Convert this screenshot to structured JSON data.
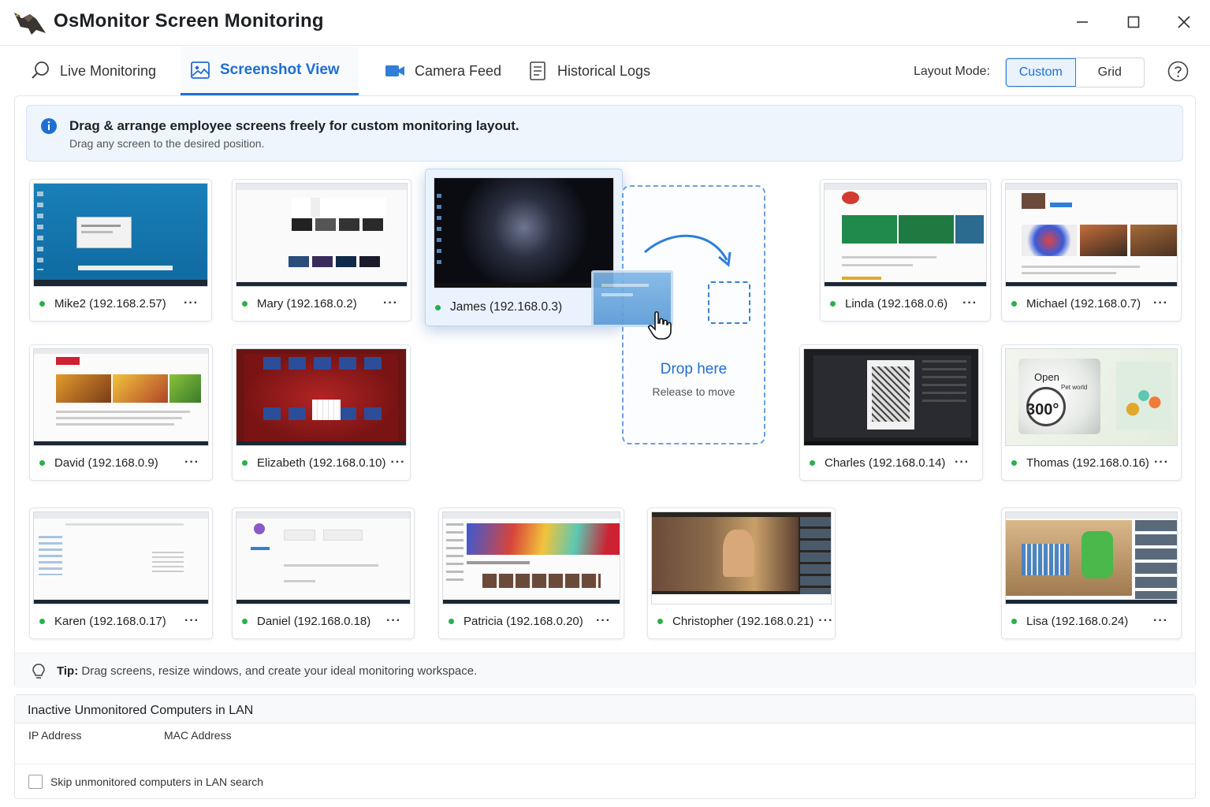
{
  "app": {
    "title": "OsMonitor Screen Monitoring"
  },
  "tabs": [
    {
      "label": "Live Monitoring",
      "icon": "search-icon"
    },
    {
      "label": "Screenshot View",
      "icon": "image-icon",
      "active": true
    },
    {
      "label": "Camera Feed",
      "icon": "camera-icon"
    },
    {
      "label": "Historical Logs",
      "icon": "log-icon"
    }
  ],
  "layout": {
    "label": "Layout Mode:",
    "options": [
      "Custom",
      "Grid"
    ],
    "selected": "Custom"
  },
  "banner": {
    "title": "Drag & arrange employee screens freely for custom monitoring layout.",
    "subtitle": "Drag any screen to the desired position."
  },
  "screens": [
    {
      "name": "Mike2 (192.168.2.57)",
      "more": "···",
      "status_color": "#2bb04a"
    },
    {
      "name": "Mary (192.168.0.2)",
      "more": "···",
      "status_color": "#2bb04a"
    },
    {
      "name": "James (192.168.0.3)",
      "more": "",
      "status_color": "#2bb04a"
    },
    {
      "name": "Linda (192.168.0.6)",
      "more": "···",
      "status_color": "#2bb04a"
    },
    {
      "name": "Michael (192.168.0.7)",
      "more": "···",
      "status_color": "#2bb04a"
    },
    {
      "name": "David (192.168.0.9)",
      "more": "···",
      "status_color": "#2bb04a"
    },
    {
      "name": "Elizabeth (192.168.0.10)",
      "more": "···",
      "status_color": "#2bb04a"
    },
    {
      "name": "Charles (192.168.0.14)",
      "more": "···",
      "status_color": "#2bb04a"
    },
    {
      "name": "Thomas (192.168.0.16)",
      "more": "···",
      "status_color": "#2bb04a"
    },
    {
      "name": "Karen (192.168.0.17)",
      "more": "···",
      "status_color": "#2bb04a"
    },
    {
      "name": "Daniel (192.168.0.18)",
      "more": "···",
      "status_color": "#2bb04a"
    },
    {
      "name": "Patricia (192.168.0.20)",
      "more": "···",
      "status_color": "#2bb04a"
    },
    {
      "name": "Christopher (192.168.0.21)",
      "more": "···",
      "status_color": "#2bb04a"
    },
    {
      "name": "Lisa (192.168.0.24)",
      "more": "···",
      "status_color": "#2bb04a"
    }
  ],
  "dropzone": {
    "title": "Drop here",
    "subtitle": "Release to move"
  },
  "thumb_text": {
    "thomas_open": "Open",
    "thomas_sub": "Pet world",
    "thomas_deg": "300°"
  },
  "tip": {
    "label": "Tip:",
    "text": " Drag screens, resize windows, and create your ideal monitoring workspace."
  },
  "inactive": {
    "title": "Inactive Unmonitored Computers in LAN",
    "columns": [
      "IP Address",
      "MAC Address"
    ],
    "skip_label": "Skip unmonitored computers in LAN search",
    "skip_checked": false
  },
  "colors": {
    "accent": "#1f6fd1",
    "online": "#2bb04a",
    "banner_bg": "#eef5fd"
  }
}
